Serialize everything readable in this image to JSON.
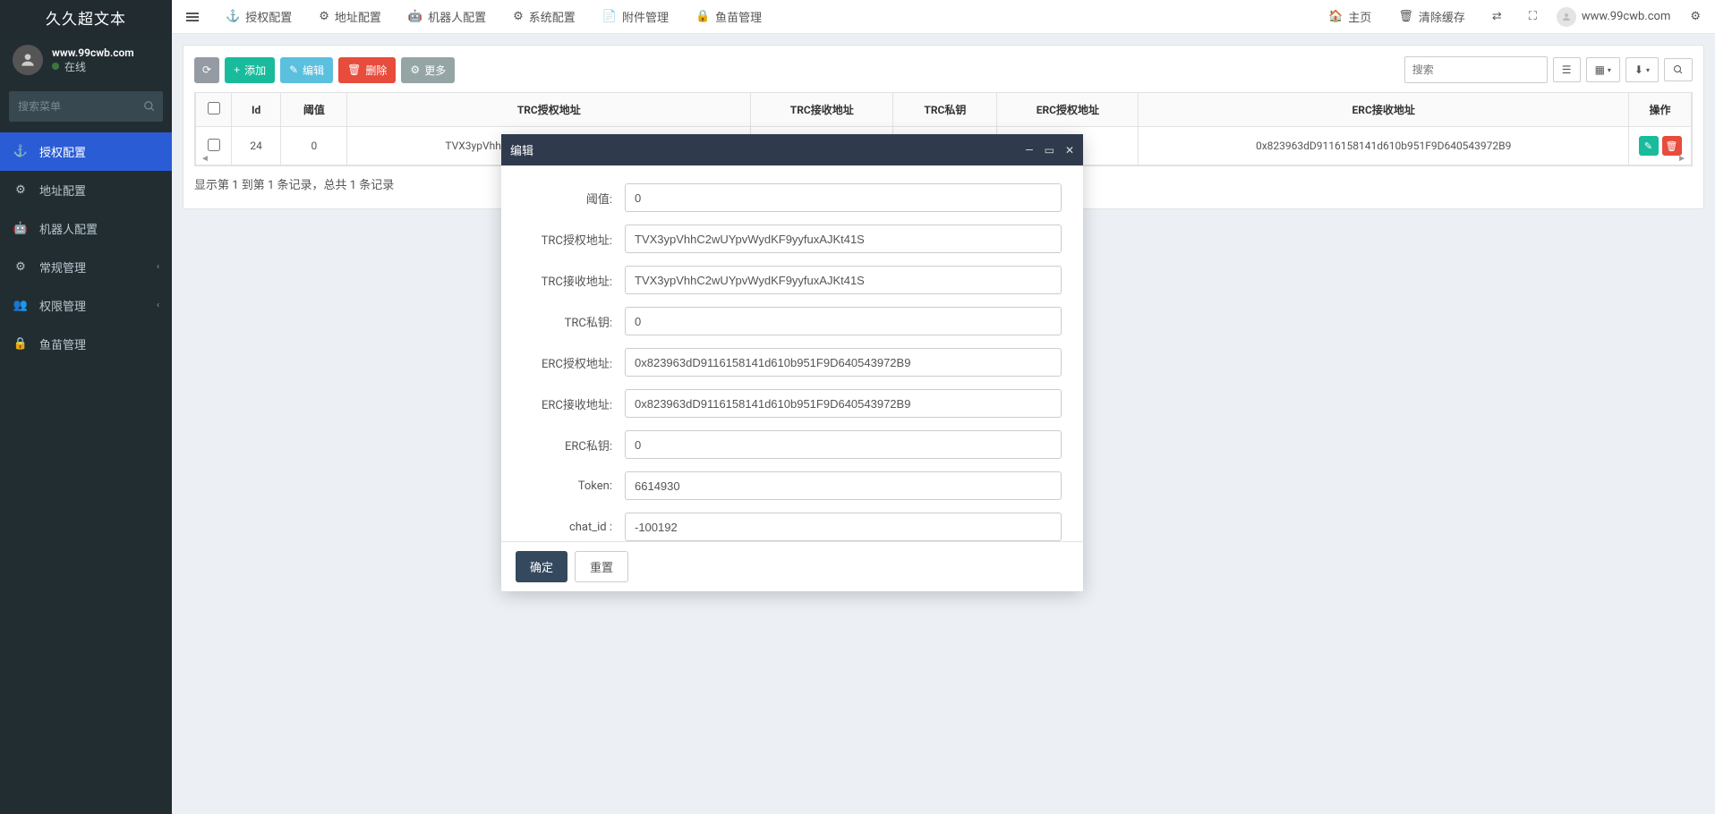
{
  "brand": "久久超文本",
  "user": {
    "name": "www.99cwb.com",
    "status": "在线"
  },
  "sidebar_search_placeholder": "搜索菜单",
  "menu": [
    {
      "label": "授权配置",
      "icon": "anchor",
      "active": true
    },
    {
      "label": "地址配置",
      "icon": "cog"
    },
    {
      "label": "机器人配置",
      "icon": "android"
    },
    {
      "label": "常规管理",
      "icon": "cogs",
      "caret": true
    },
    {
      "label": "权限管理",
      "icon": "group",
      "caret": true
    },
    {
      "label": "鱼苗管理",
      "icon": "lock"
    }
  ],
  "topnav": [
    {
      "label": "授权配置",
      "icon": "anchor"
    },
    {
      "label": "地址配置",
      "icon": "cog"
    },
    {
      "label": "机器人配置",
      "icon": "android"
    },
    {
      "label": "系统配置",
      "icon": "cog"
    },
    {
      "label": "附件管理",
      "icon": "file"
    },
    {
      "label": "鱼苗管理",
      "icon": "lock"
    }
  ],
  "topright": {
    "home": "主页",
    "clear": "清除缓存",
    "username": "www.99cwb.com"
  },
  "toolbar": {
    "refresh": "",
    "add": "添加",
    "edit": "编辑",
    "delete": "删除",
    "more": "更多"
  },
  "search_placeholder": "搜索",
  "table": {
    "headers": [
      "",
      "Id",
      "阈值",
      "TRC授权地址",
      "TRC接收地址",
      "TRC私钥",
      "ERC授权地址",
      "ERC接收地址",
      "操作"
    ],
    "rows": [
      {
        "id": "24",
        "threshold": "0",
        "trc_auth": "TVX3ypVhhC2wUYpvWydKF9yyfuxAJKt41S",
        "trc_recv": "",
        "trc_pk": "",
        "erc_auth": "",
        "erc_recv": "0x823963dD9116158141d610b951F9D640543972B9"
      }
    ]
  },
  "record_info": "显示第 1 到第 1 条记录，总共 1 条记录",
  "modal": {
    "title": "编辑",
    "fields": {
      "threshold": {
        "label": "阈值:",
        "value": "0"
      },
      "trc_auth": {
        "label": "TRC授权地址:",
        "value": "TVX3ypVhhC2wUYpvWydKF9yyfuxAJKt41S"
      },
      "trc_recv": {
        "label": "TRC接收地址:",
        "value": "TVX3ypVhhC2wUYpvWydKF9yyfuxAJKt41S"
      },
      "trc_pk": {
        "label": "TRC私钥:",
        "value": "0"
      },
      "erc_auth": {
        "label": "ERC授权地址:",
        "value": "0x823963dD9116158141d610b951F9D640543972B9"
      },
      "erc_recv": {
        "label": "ERC接收地址:",
        "value": "0x823963dD9116158141d610b951F9D640543972B9"
      },
      "erc_pk": {
        "label": "ERC私钥:",
        "value": "0"
      },
      "token": {
        "label": "Token:",
        "value": "6614930"
      },
      "chat_id": {
        "label": "chat_id :",
        "value": "-100192"
      }
    },
    "ok": "确定",
    "reset": "重置"
  }
}
